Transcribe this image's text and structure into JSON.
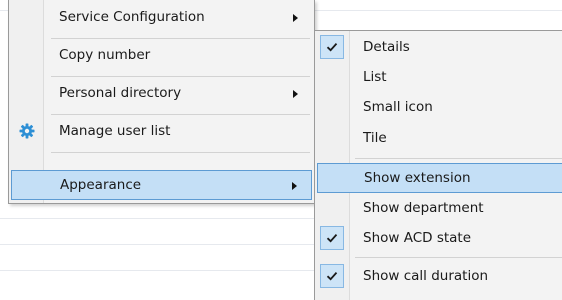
{
  "main_menu": {
    "items": [
      {
        "label": "Service Configuration",
        "has_submenu": true
      },
      {
        "label": "Copy number",
        "has_submenu": false
      },
      {
        "label": "Personal directory",
        "has_submenu": true
      },
      {
        "label": "Manage user list",
        "has_submenu": false,
        "icon": "gear-icon"
      },
      {
        "label": "Appearance",
        "has_submenu": true,
        "highlighted": true
      }
    ]
  },
  "appearance_submenu": {
    "items": [
      {
        "label": "Details",
        "checked": true
      },
      {
        "label": "List",
        "checked": false
      },
      {
        "label": "Small icon",
        "checked": false
      },
      {
        "label": "Tile",
        "checked": false
      },
      {
        "label": "Show extension",
        "checked": false,
        "highlighted": true
      },
      {
        "label": "Show department",
        "checked": false
      },
      {
        "label": "Show ACD state",
        "checked": true
      },
      {
        "label": "Show call duration",
        "checked": true
      }
    ]
  },
  "colors": {
    "highlight": "#c4dff6",
    "highlight_border": "#5d9bd3",
    "check_background": "#cde4f7",
    "gear_icon": "#2d8fd5"
  }
}
